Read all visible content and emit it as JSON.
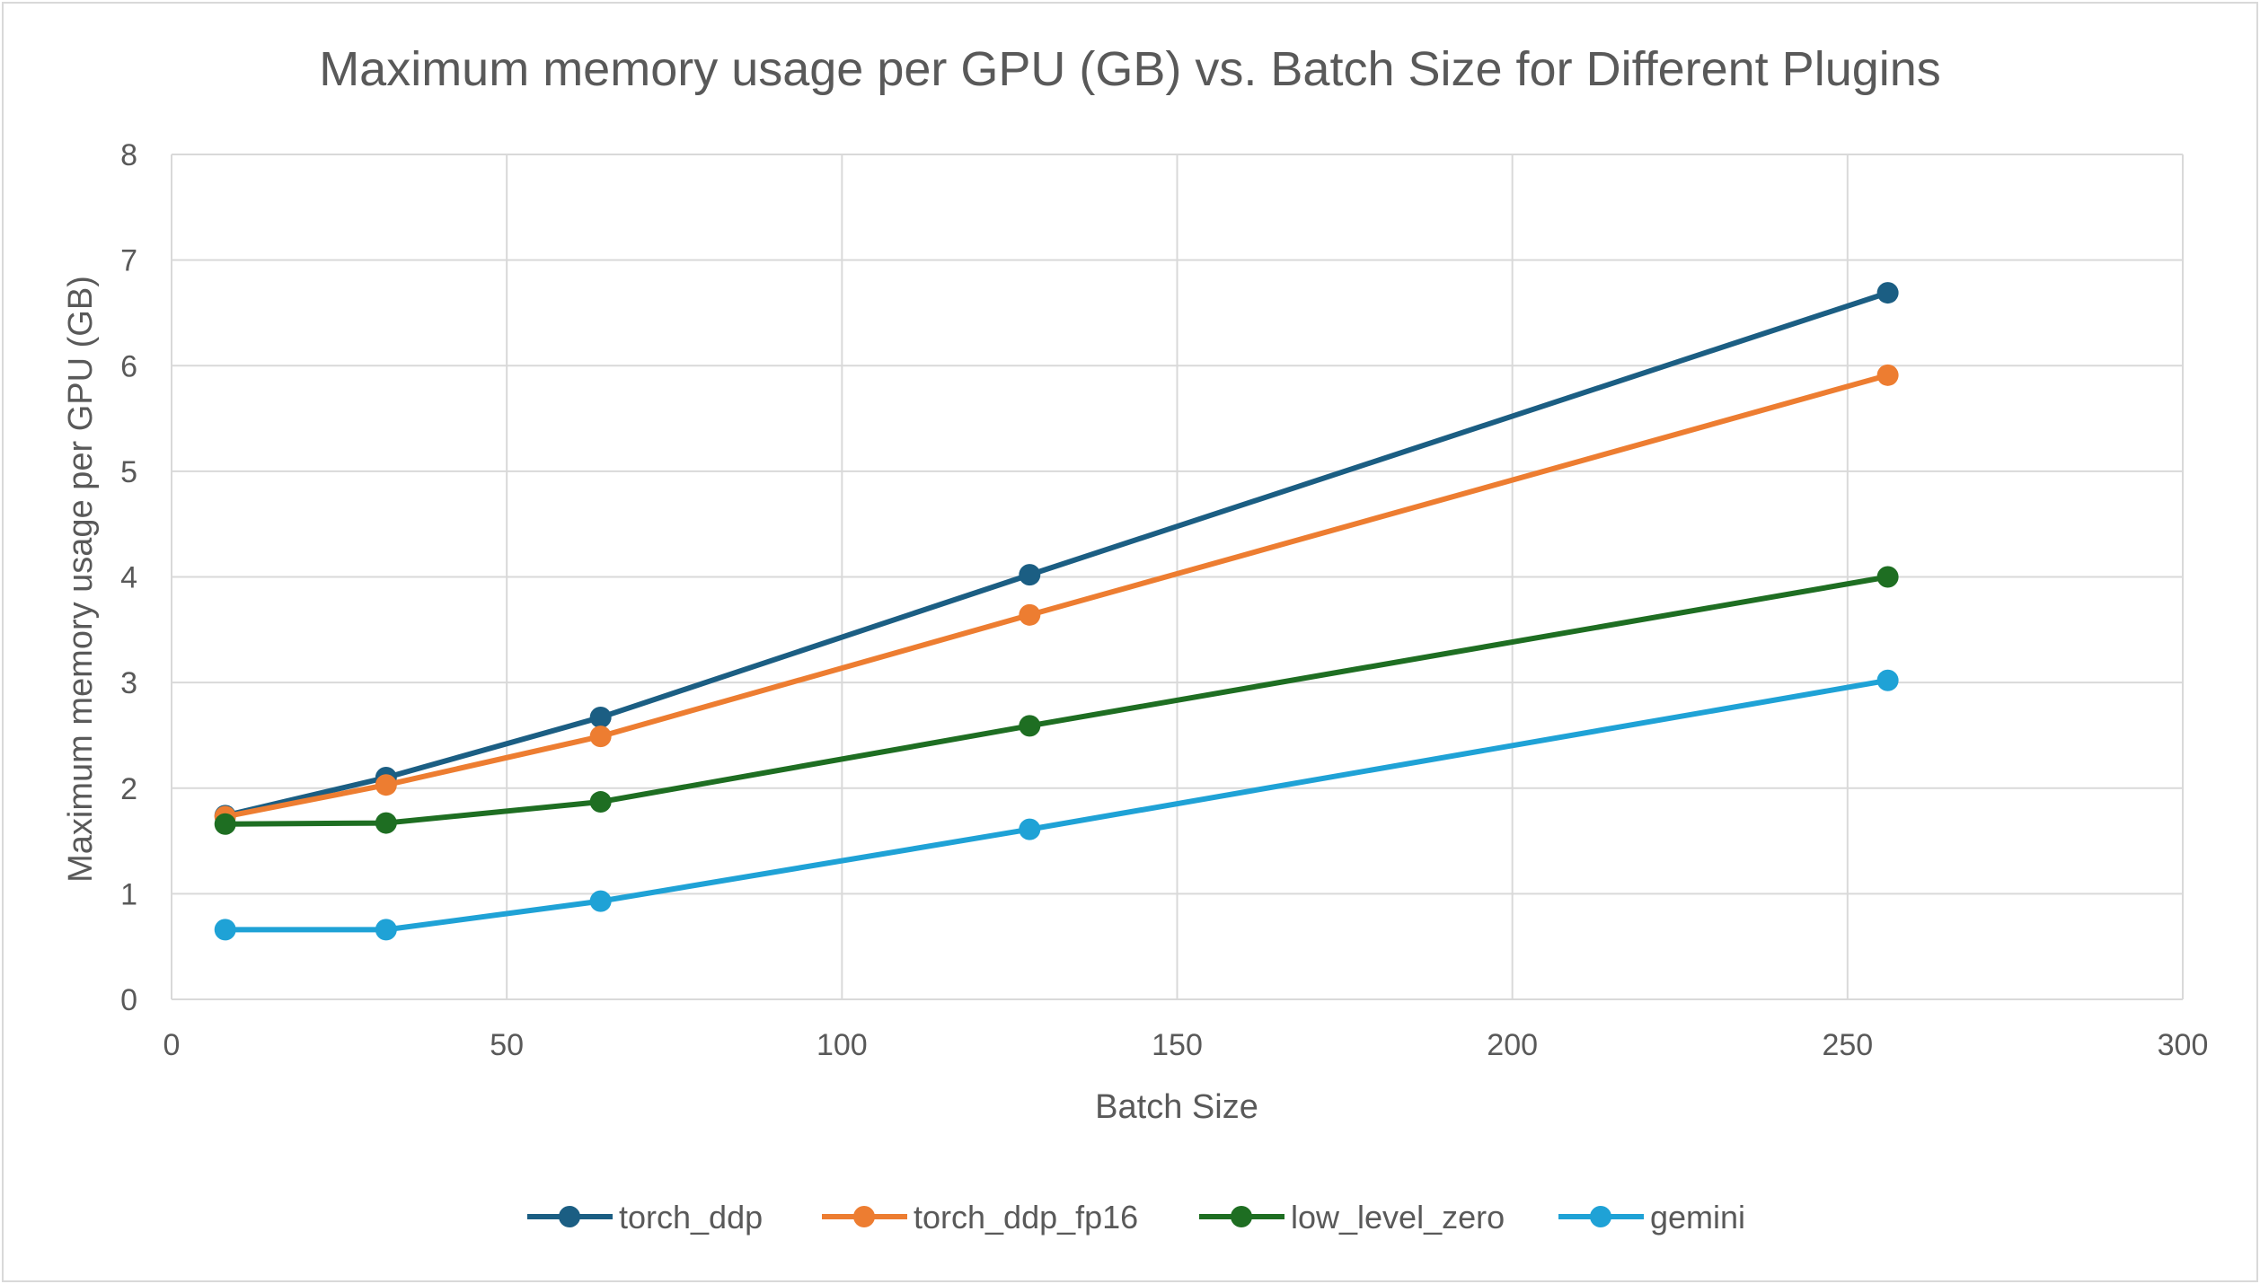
{
  "chart_data": {
    "type": "line",
    "title": "Maximum memory usage per GPU (GB) vs. Batch Size for Different Plugins",
    "xlabel": "Batch Size",
    "ylabel": "Maximum memory usage per GPU (GB)",
    "xlim": [
      0,
      300
    ],
    "ylim": [
      0,
      8
    ],
    "xticks": [
      0,
      50,
      100,
      150,
      200,
      250,
      300
    ],
    "yticks": [
      0,
      1,
      2,
      3,
      4,
      5,
      6,
      7,
      8
    ],
    "grid": true,
    "legend_position": "bottom",
    "x": [
      8,
      32,
      64,
      128,
      256
    ],
    "series": [
      {
        "name": "torch_ddp",
        "color": "#1b5e83",
        "values": [
          1.74,
          2.1,
          2.67,
          4.02,
          6.69
        ]
      },
      {
        "name": "torch_ddp_fp16",
        "color": "#ed7d31",
        "values": [
          1.73,
          2.03,
          2.49,
          3.64,
          5.91
        ]
      },
      {
        "name": "low_level_zero",
        "color": "#1e6e22",
        "values": [
          1.66,
          1.67,
          1.87,
          2.59,
          4.0
        ]
      },
      {
        "name": "gemini",
        "color": "#1fa2d6",
        "values": [
          0.66,
          0.66,
          0.93,
          1.61,
          3.02
        ]
      }
    ]
  }
}
